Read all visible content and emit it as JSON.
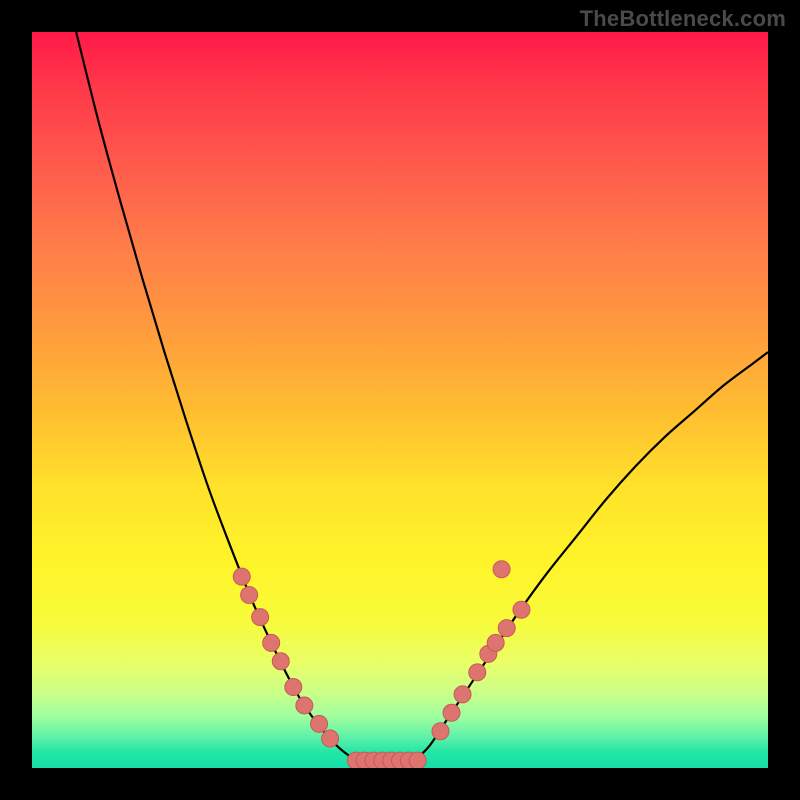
{
  "watermark": "TheBottleneck.com",
  "chart_data": {
    "type": "line",
    "title": "",
    "xlabel": "",
    "ylabel": "",
    "xlim": [
      0,
      100
    ],
    "ylim": [
      0,
      100
    ],
    "series": [
      {
        "name": "left-curve",
        "x": [
          6,
          9,
          12,
          15,
          18,
          21,
          24,
          27,
          30,
          33,
          35,
          37,
          40,
          42,
          44
        ],
        "y": [
          100,
          88,
          77,
          66.5,
          56.5,
          47,
          38,
          30,
          22.5,
          16,
          12,
          8.5,
          4.5,
          2.5,
          1
        ]
      },
      {
        "name": "right-curve",
        "x": [
          52,
          54,
          56,
          58,
          60,
          63,
          66,
          70,
          74,
          78,
          82,
          86,
          90,
          94,
          98,
          100
        ],
        "y": [
          1,
          3,
          6,
          9,
          12,
          16.5,
          21,
          26.5,
          31.5,
          36.5,
          41,
          45,
          48.5,
          52,
          55,
          56.5
        ]
      }
    ],
    "flat_segment": {
      "x0": 44,
      "x1": 52,
      "y": 1
    },
    "dots_left": [
      {
        "x": 28.5,
        "y": 26
      },
      {
        "x": 29.5,
        "y": 23.5
      },
      {
        "x": 31,
        "y": 20.5
      },
      {
        "x": 32.5,
        "y": 17
      },
      {
        "x": 33.8,
        "y": 14.5
      },
      {
        "x": 35.5,
        "y": 11
      },
      {
        "x": 37,
        "y": 8.5
      },
      {
        "x": 39,
        "y": 6
      },
      {
        "x": 40.5,
        "y": 4
      }
    ],
    "dots_right": [
      {
        "x": 55.5,
        "y": 5
      },
      {
        "x": 57,
        "y": 7.5
      },
      {
        "x": 58.5,
        "y": 10
      },
      {
        "x": 60.5,
        "y": 13
      },
      {
        "x": 62,
        "y": 15.5
      },
      {
        "x": 63,
        "y": 17
      },
      {
        "x": 64.5,
        "y": 19
      },
      {
        "x": 66.5,
        "y": 21.5
      },
      {
        "x": 63.8,
        "y": 27
      }
    ],
    "flat_dots": [
      {
        "x": 44,
        "y": 1
      },
      {
        "x": 45.2,
        "y": 1
      },
      {
        "x": 46.4,
        "y": 1
      },
      {
        "x": 47.6,
        "y": 1
      },
      {
        "x": 48.8,
        "y": 1
      },
      {
        "x": 50,
        "y": 1
      },
      {
        "x": 51.2,
        "y": 1
      },
      {
        "x": 52.4,
        "y": 1
      }
    ],
    "colors": {
      "curve": "#000000",
      "dot_fill": "#dd7470",
      "dot_stroke": "#c85a56"
    }
  }
}
